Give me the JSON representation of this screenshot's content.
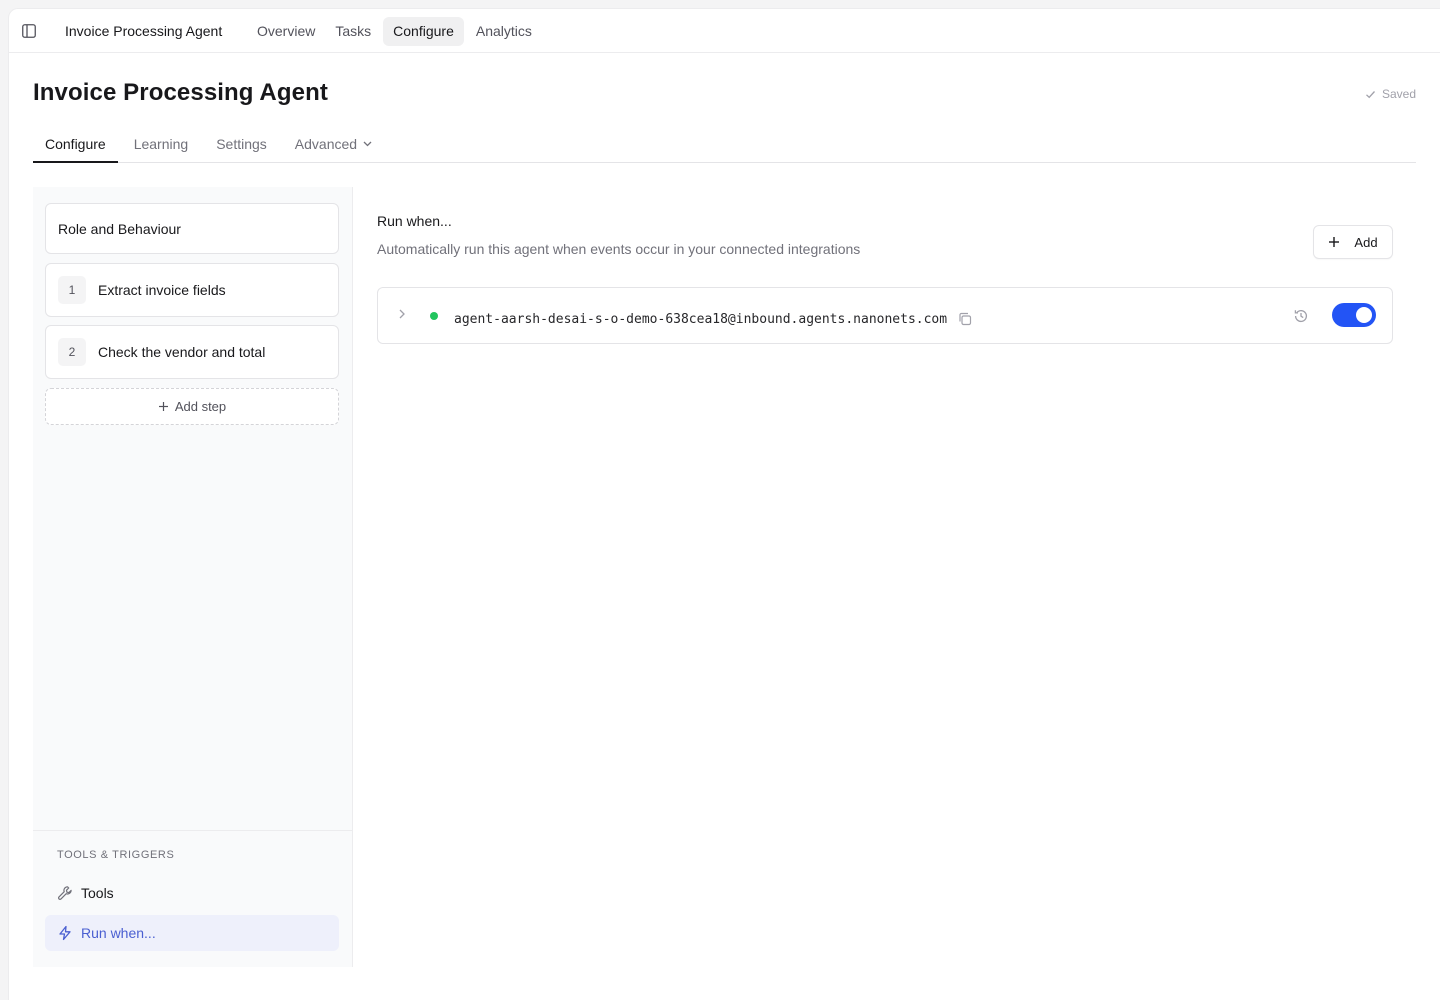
{
  "topbar": {
    "app_title": "Invoice Processing Agent",
    "nav": [
      {
        "label": "Overview"
      },
      {
        "label": "Tasks"
      },
      {
        "label": "Configure"
      },
      {
        "label": "Analytics"
      }
    ],
    "active_nav": "Configure"
  },
  "header": {
    "title": "Invoice Processing Agent",
    "saved_label": "Saved"
  },
  "tabs": [
    {
      "label": "Configure"
    },
    {
      "label": "Learning"
    },
    {
      "label": "Settings"
    },
    {
      "label": "Advanced"
    }
  ],
  "active_tab": "Configure",
  "left_panel": {
    "role_card": "Role and Behaviour",
    "steps": [
      {
        "number": "1",
        "label": "Extract invoice fields"
      },
      {
        "number": "2",
        "label": "Check the vendor and total"
      }
    ],
    "add_step_label": "Add step",
    "tools_triggers": {
      "heading": "TOOLS & TRIGGERS",
      "items": [
        {
          "label": "Tools",
          "icon": "wrench-icon"
        },
        {
          "label": "Run when...",
          "icon": "lightning-icon"
        }
      ],
      "active_item": "Run when..."
    }
  },
  "main": {
    "title": "Run when...",
    "subtitle": "Automatically run this agent when events occur in your connected integrations",
    "add_label": "Add",
    "triggers": [
      {
        "address": "agent-aarsh-desai-s-o-demo-638cea18@inbound.agents.nanonets.com",
        "status": "active",
        "enabled": true
      }
    ]
  },
  "colors": {
    "accent_blue": "#2354f5",
    "status_green": "#22c55e",
    "active_item_bg": "#eef0fb",
    "active_item_text": "#4a5fd1"
  }
}
